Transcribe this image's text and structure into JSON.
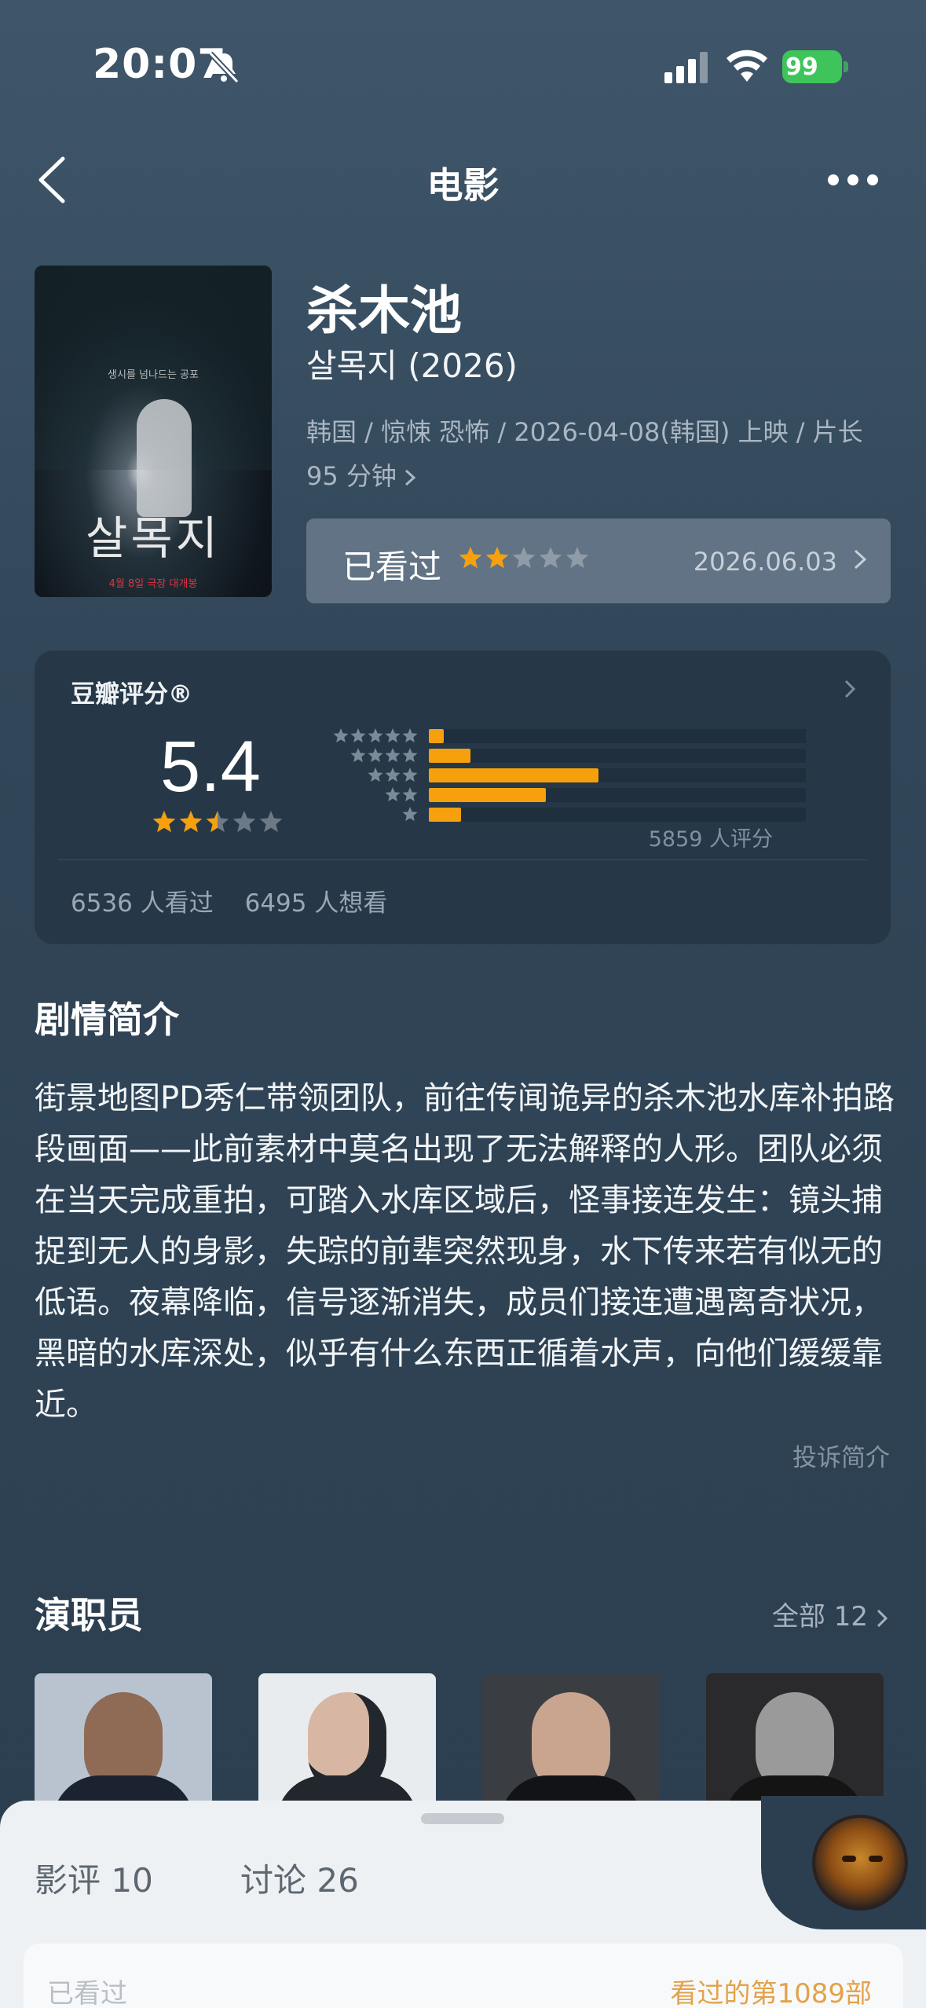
{
  "status_bar": {
    "time": "20:07",
    "battery": "99"
  },
  "nav": {
    "title": "电影"
  },
  "movie": {
    "title": "杀木池",
    "original_title": "살목지 (2026)",
    "meta": "韩国 / 惊悚 恐怖 / 2026-04-08(韩国) 上映 / 片长 95 分钟",
    "poster_title": "살목지",
    "poster_tagline": "생시를 넘나드는 공포",
    "poster_release": "4월 8일 극장 대개봉"
  },
  "watched": {
    "label": "已看过",
    "stars": 2,
    "date": "2026.06.03"
  },
  "rating": {
    "label": "豆瓣评分®",
    "score": "5.4",
    "stars": 2.5,
    "count_text": "5859 人评分",
    "seen_text": "6536 人看过",
    "want_text": "6495 人想看",
    "distribution": [
      {
        "stars": 5,
        "fraction": 0.04
      },
      {
        "stars": 4,
        "fraction": 0.11
      },
      {
        "stars": 3,
        "fraction": 0.45
      },
      {
        "stars": 2,
        "fraction": 0.31
      },
      {
        "stars": 1,
        "fraction": 0.085
      }
    ]
  },
  "synopsis": {
    "title": "剧情简介",
    "text": "街景地图PD秀仁带领团队，前往传闻诡异的杀木池水库补拍路段画面——此前素材中莫名出现了无法解释的人形。团队必须在当天完成重拍，可踏入水库区域后，怪事接连发生：镜头捕捉到无人的身影，失踪的前辈突然现身，水下传来若有似无的低语。夜幕降临，信号逐渐消失，成员们接连遭遇离奇状况，黑暗的水库深处，似乎有什么东西正循着水声，向他们缓缓靠近。",
    "report": "投诉简介"
  },
  "cast": {
    "title": "演职员",
    "all": "全部 12"
  },
  "sheet": {
    "tab_reviews": "影评 10",
    "tab_discussions": "讨论 26",
    "card_left": "已看过",
    "card_right": "看过的第1089部"
  },
  "colors": {
    "accent_star": "#f5a00c",
    "bg": "#314658",
    "card": "#263747"
  }
}
